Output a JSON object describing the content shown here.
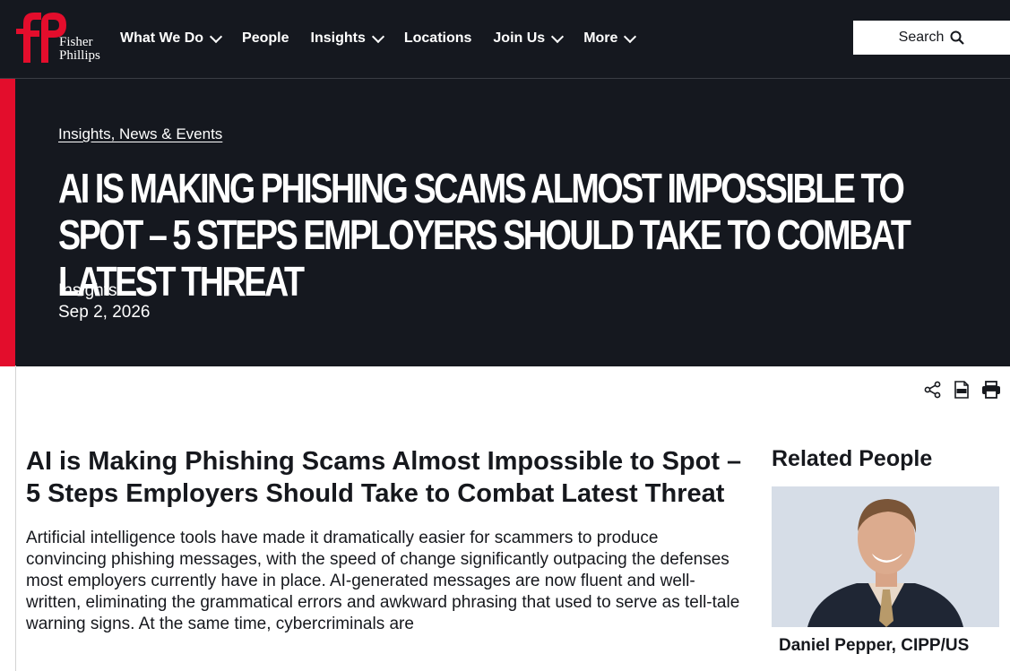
{
  "brand": {
    "mark": "fP",
    "line1": "Fisher",
    "line2": "Phillips",
    "accent": "#e30d2c",
    "dark": "#15181f"
  },
  "nav": {
    "items": [
      {
        "label": "What We Do",
        "dropdown": true
      },
      {
        "label": "People",
        "dropdown": false
      },
      {
        "label": "Insights",
        "dropdown": true
      },
      {
        "label": "Locations",
        "dropdown": false
      },
      {
        "label": "Join Us",
        "dropdown": true
      },
      {
        "label": "More",
        "dropdown": true
      }
    ],
    "search_label": "Search"
  },
  "hero": {
    "breadcrumb": "Insights, News & Events",
    "title": "AI IS MAKING PHISHING SCAMS ALMOST IMPOSSIBLE TO SPOT – 5 STEPS EMPLOYERS SHOULD TAKE TO COMBAT LATEST THREAT",
    "type": "Insights",
    "date": "Sep 2, 2026"
  },
  "tools": {
    "share_icon": "share-icon",
    "pdf_icon": "pdf-icon",
    "print_icon": "print-icon"
  },
  "article": {
    "title": "AI is Making Phishing Scams Almost Impossible to Spot – 5 Steps Employers Should Take to Combat Latest Threat",
    "intro": "Artificial intelligence tools have made it dramatically easier for scammers to produce convincing phishing messages, with the speed of change significantly outpacing the defenses most employers currently have in place. AI-generated messages are now fluent and well-written, eliminating the grammatical errors and awkward phrasing that used to serve as tell-tale warning signs. At the same time, cybercriminals are"
  },
  "sidebar": {
    "heading": "Related People",
    "people": [
      {
        "name": "Daniel Pepper, CIPP/US"
      }
    ]
  }
}
